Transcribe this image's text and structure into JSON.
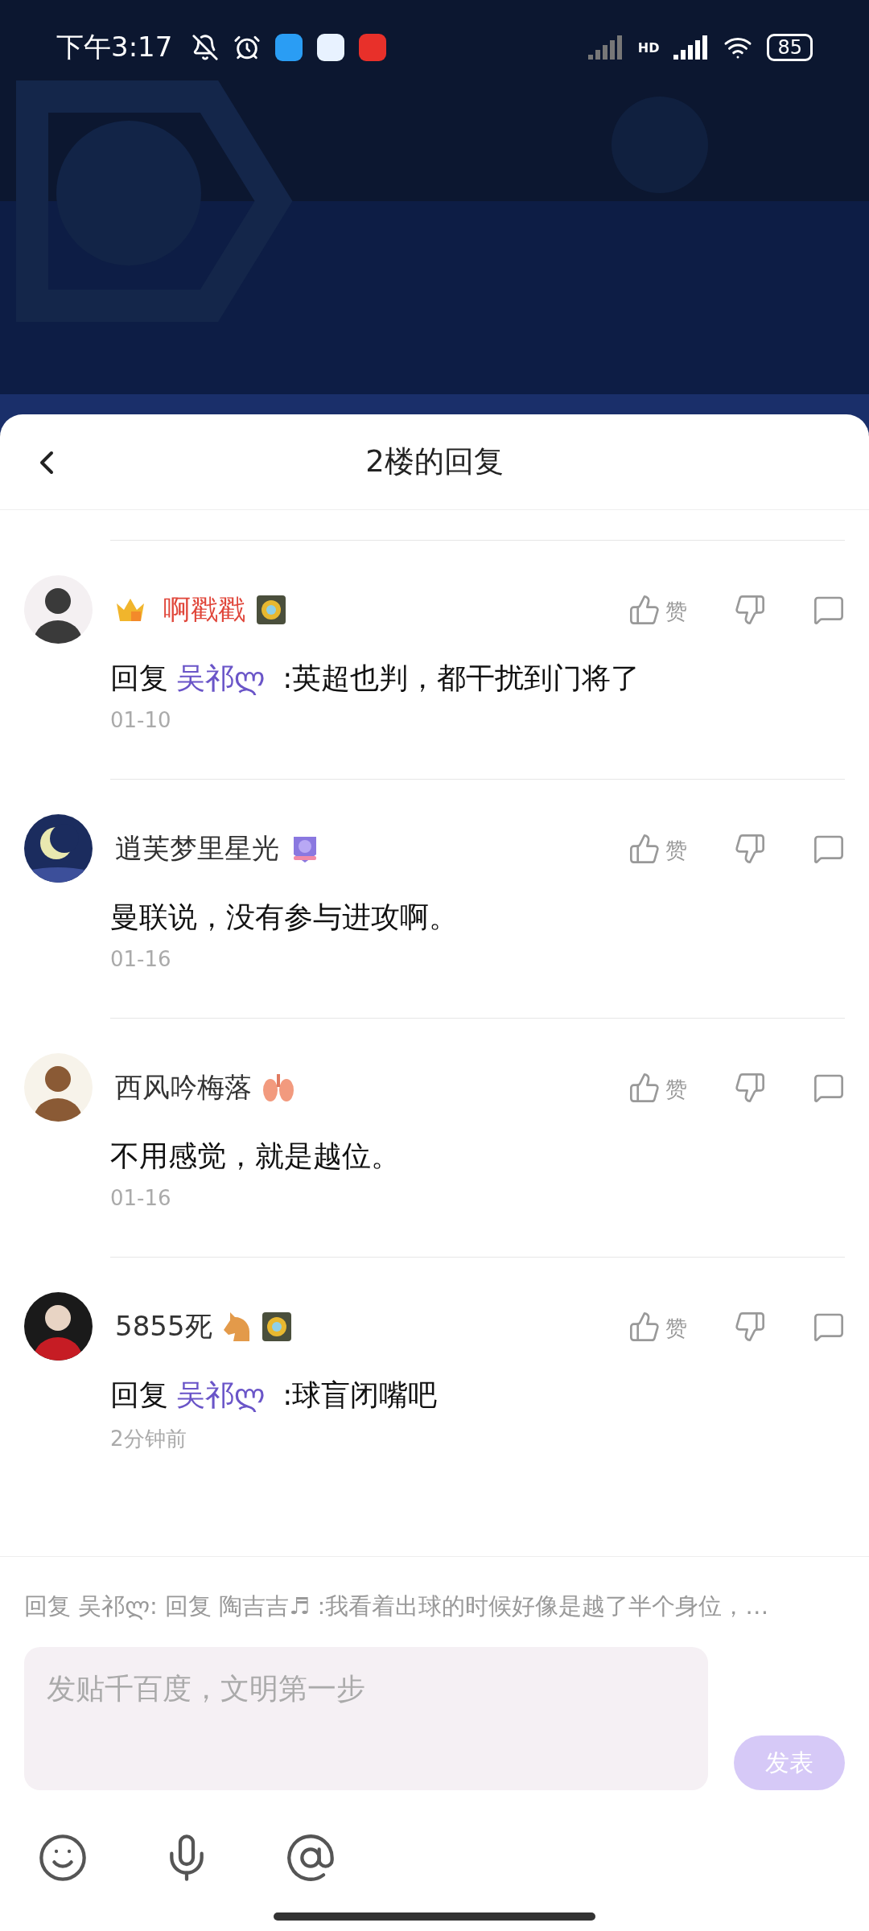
{
  "status_bar": {
    "time": "下午3:17",
    "network": "HD",
    "battery": "85"
  },
  "header": {
    "title": "2楼的回复"
  },
  "comments": [
    {
      "name": "啊戳戳",
      "vip": true,
      "badges": [
        {
          "kind": "medal"
        }
      ],
      "reply_label": "回复",
      "mention": "吴祁ლ",
      "text": ":英超也判，都干扰到门将了",
      "time": "01-10",
      "like_label": "赞"
    },
    {
      "name": "逍芙梦里星光",
      "vip": false,
      "badges": [
        {
          "kind": "level"
        }
      ],
      "text": "曼联说，没有参与进攻啊。",
      "time": "01-16",
      "like_label": "赞"
    },
    {
      "name": "西风吟梅落",
      "vip": false,
      "badges": [
        {
          "kind": "lungs"
        }
      ],
      "text": "不用感觉，就是越位。",
      "time": "01-16",
      "like_label": "赞"
    },
    {
      "name": "5855死",
      "vip": false,
      "badges": [
        {
          "kind": "horse"
        },
        {
          "kind": "medal"
        }
      ],
      "reply_label": "回复",
      "mention": "吴祁ლ",
      "text": ":球盲闭嘴吧",
      "time": "2分钟前",
      "like_label": "赞"
    }
  ],
  "composer": {
    "reply_preview": "回复 吴祁ლ: 回复 陶吉吉♬ :我看着出球的时候好像是越了半个身位，…",
    "placeholder": "发贴千百度，文明第一步",
    "send_label": "发表"
  }
}
